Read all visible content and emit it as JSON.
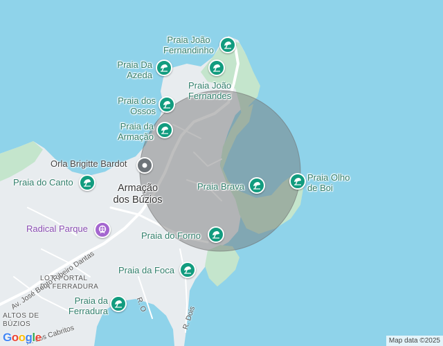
{
  "map": {
    "water_color": "#8fd3ea",
    "land_color": "#e8ecef",
    "green_color": "#c4e5cc",
    "circle_fill": "#808080",
    "pin_color": "#129c7f",
    "poi_color": "#8a4db2"
  },
  "beaches": [
    {
      "name": "joao-fernandinho",
      "lines": [
        "Praia João",
        "Fernandinho"
      ]
    },
    {
      "name": "da-azeda",
      "lines": [
        "Praia Da",
        "Azeda"
      ]
    },
    {
      "name": "joao-fernandes",
      "lines": [
        "Praia João",
        "Fernandes"
      ]
    },
    {
      "name": "dos-ossos",
      "lines": [
        "Praia dos",
        "Ossos"
      ]
    },
    {
      "name": "da-armacao",
      "lines": [
        "Praia da",
        "Armação"
      ]
    },
    {
      "name": "do-canto",
      "lines": [
        "Praia do Canto"
      ]
    },
    {
      "name": "brava",
      "lines": [
        "Praia Brava"
      ]
    },
    {
      "name": "olho-de-boi",
      "lines": [
        "Praia Olho",
        "de Boi"
      ]
    },
    {
      "name": "do-forno",
      "lines": [
        "Praia do Forno"
      ]
    },
    {
      "name": "da-foca",
      "lines": [
        "Praia da Foca"
      ]
    },
    {
      "name": "da-ferradura",
      "lines": [
        "Praia da",
        "Ferradura"
      ]
    }
  ],
  "places": {
    "town": [
      "Armação",
      "dos Búzios"
    ],
    "orla": "Orla Brigitte Bardot",
    "radical": "Radical Parque",
    "lot_portal": [
      "LOT. PORTAL",
      "DA FERRADURA"
    ],
    "altos": [
      "ALTOS DE",
      "BÚZIOS"
    ]
  },
  "streets": {
    "jose_bento": "Av. José Bento Ribeiro Dantas",
    "r_o": "R. O",
    "r_dois": "R. Dois",
    "cabritos": "R. dos Cabritos"
  },
  "footer": {
    "logo": "Google",
    "credit": "Map data ©2025"
  }
}
